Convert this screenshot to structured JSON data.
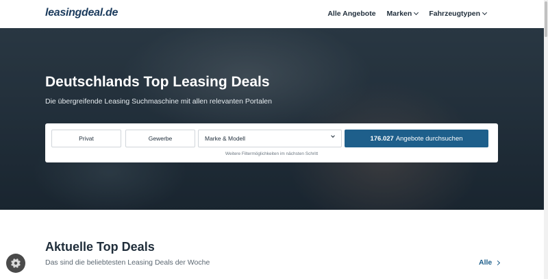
{
  "header": {
    "logo": "leasingdeal.de",
    "nav": [
      {
        "label": "Alle Angebote",
        "has_dropdown": false
      },
      {
        "label": "Marken",
        "has_dropdown": true
      },
      {
        "label": "Fahrzeugtypen",
        "has_dropdown": true
      }
    ]
  },
  "hero": {
    "title": "Deutschlands Top Leasing Deals",
    "subtitle": "Die übergreifende Leasing Suchmaschine mit allen relevanten Portalen"
  },
  "search": {
    "segment_privat": "Privat",
    "segment_gewerbe": "Gewerbe",
    "select_value": "Marke & Modell",
    "button_count": "176.027",
    "button_label": "Angebote durchsuchen",
    "filter_note": "Weitere Filtermöglichkeiten im nächsten Schritt"
  },
  "section": {
    "title": "Aktuelle Top Deals",
    "subtitle": "Das sind die beliebtesten Leasing Deals der Woche",
    "link_label": "Alle"
  },
  "colors": {
    "accent": "#1e5f8b",
    "logo": "#1a3a5c"
  },
  "icons": {
    "cookie": "cookie-icon",
    "dropdown": "chevron-down-icon",
    "link_arrow": "chevron-right-icon"
  }
}
